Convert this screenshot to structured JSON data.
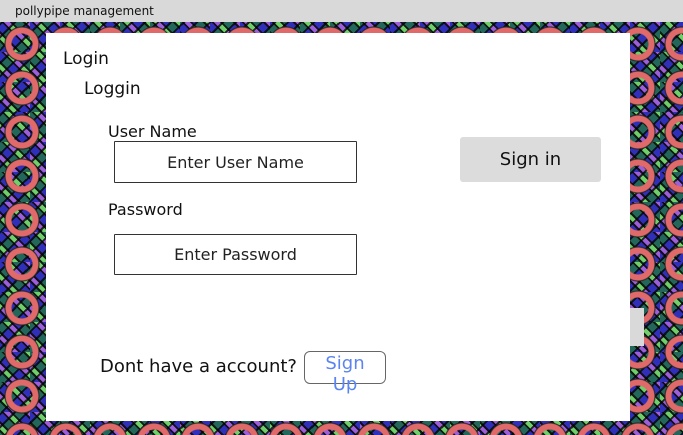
{
  "window": {
    "title": "pollypipe management"
  },
  "form": {
    "title": "Login",
    "subtitle": "Loggin",
    "username_label": "User Name",
    "username_placeholder": "Enter User Name",
    "password_label": "Password",
    "password_placeholder": "Enter Password",
    "signin_label": "Sign in",
    "account_prompt": "Dont have a account?",
    "signup_label": "Sign Up"
  },
  "colors": {
    "signup_link": "#5b84f0",
    "signin_button_bg": "#dcdcdc",
    "titlebar_bg": "#d9d9d9"
  }
}
